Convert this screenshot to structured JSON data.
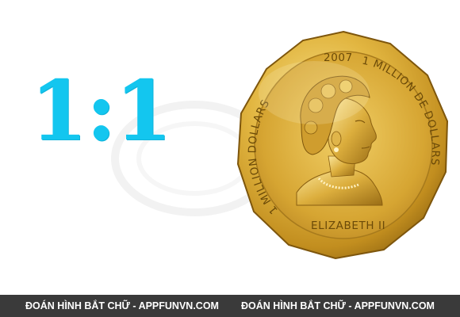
{
  "clue": {
    "ratio_text": "1:1",
    "ratio_color": "#13c6ef"
  },
  "coin": {
    "top_text": "2007",
    "left_arc_text": "1 MILLION DOLLARS",
    "right_arc_text": "1 MILLION DE DOLLARS",
    "bottom_text": "ELIZABETH II",
    "gold_light": "#f3d873",
    "gold_mid": "#d8a72f",
    "gold_dark": "#8c6210"
  },
  "footer": {
    "left_text": "ĐOÁN HÌNH BẮT CHỮ - APPFUNVN.COM",
    "right_text": "ĐOÁN HÌNH BẮT CHỮ - APPFUNVN.COM",
    "background": "#3a3a3a"
  }
}
